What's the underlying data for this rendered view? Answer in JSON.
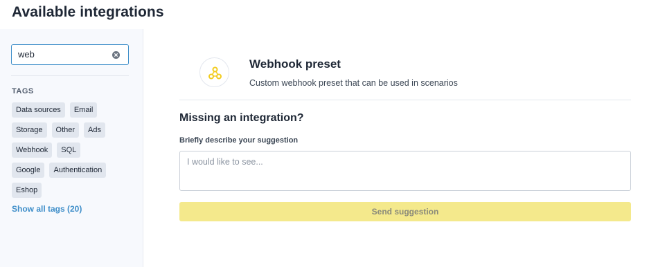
{
  "page": {
    "title": "Available integrations"
  },
  "sidebar": {
    "search": {
      "value": "web",
      "placeholder": ""
    },
    "tags_heading": "TAGS",
    "tag_rows": [
      [
        "Data sources",
        "Email"
      ],
      [
        "Storage",
        "Other",
        "Ads"
      ],
      [
        "Webhook",
        "SQL"
      ],
      [
        "Google",
        "Authentication"
      ],
      [
        "Eshop"
      ]
    ],
    "show_all_tags": "Show all tags (20)"
  },
  "preset": {
    "title": "Webhook preset",
    "description": "Custom webhook preset that can be used in scenarios",
    "icon": "webhook-icon"
  },
  "suggestion": {
    "heading": "Missing an integration?",
    "label": "Briefly describe your suggestion",
    "placeholder": "I would like to see...",
    "button_label": "Send suggestion"
  },
  "colors": {
    "accent": "#3e8ec9",
    "button_bg": "#f4e98c",
    "icon_yellow": "#f2cc1e"
  }
}
